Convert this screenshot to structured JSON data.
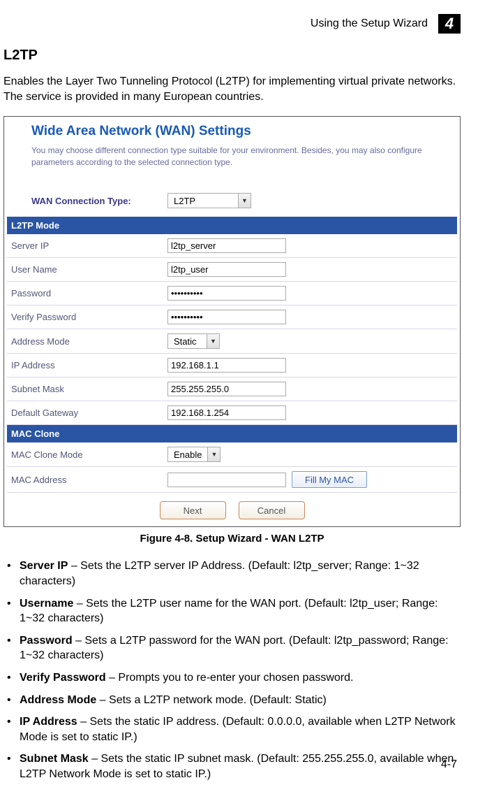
{
  "header": {
    "section": "Using the Setup Wizard",
    "chapter": "4"
  },
  "title": "L2TP",
  "intro": "Enables the Layer Two Tunneling Protocol (L2TP) for implementing virtual private networks. The service is provided in many European countries.",
  "screenshot": {
    "title": "Wide Area Network (WAN) Settings",
    "desc": "You may choose different connection type suitable for your environment. Besides, you may also configure parameters according to the selected connection type.",
    "conn_label": "WAN Connection Type:",
    "conn_value": "L2TP",
    "sections": {
      "l2tp_mode": "L2TP Mode",
      "mac_clone": "MAC Clone"
    },
    "fields": {
      "server_ip_label": "Server IP",
      "server_ip_value": "l2tp_server",
      "user_name_label": "User Name",
      "user_name_value": "l2tp_user",
      "password_label": "Password",
      "password_value": "••••••••••",
      "verify_password_label": "Verify Password",
      "verify_password_value": "••••••••••",
      "address_mode_label": "Address Mode",
      "address_mode_value": "Static",
      "ip_address_label": "IP Address",
      "ip_address_value": "192.168.1.1",
      "subnet_mask_label": "Subnet Mask",
      "subnet_mask_value": "255.255.255.0",
      "default_gateway_label": "Default Gateway",
      "default_gateway_value": "192.168.1.254",
      "mac_clone_mode_label": "MAC Clone Mode",
      "mac_clone_mode_value": "Enable",
      "mac_address_label": "MAC Address",
      "mac_address_value": ""
    },
    "buttons": {
      "fill_my_mac": "Fill My MAC",
      "next": "Next",
      "cancel": "Cancel"
    }
  },
  "figure_caption": "Figure 4-8.   Setup Wizard - WAN L2TP",
  "bullets": [
    {
      "bold": "Server IP",
      "rest": " – Sets the L2TP server IP Address. (Default: l2tp_server; Range: 1~32 characters)"
    },
    {
      "bold": "Username",
      "rest": " – Sets the L2TP user name for the WAN port. (Default: l2tp_user; Range: 1~32 characters)"
    },
    {
      "bold": "Password",
      "rest": " – Sets a L2TP password for the WAN port. (Default: l2tp_password; Range: 1~32 characters)"
    },
    {
      "bold": "Verify Password",
      "rest": " – Prompts you to re-enter your chosen password."
    },
    {
      "bold": "Address Mode",
      "rest": " – Sets a L2TP network mode. (Default: Static)"
    },
    {
      "bold": "IP Address",
      "rest": " – Sets the static IP address. (Default: 0.0.0.0, available when L2TP Network Mode is set to static IP.)"
    },
    {
      "bold": "Subnet Mask",
      "rest": " – Sets the static IP subnet mask. (Default: 255.255.255.0, available when L2TP Network Mode is set to static IP.)"
    }
  ],
  "page_num": "4-7"
}
